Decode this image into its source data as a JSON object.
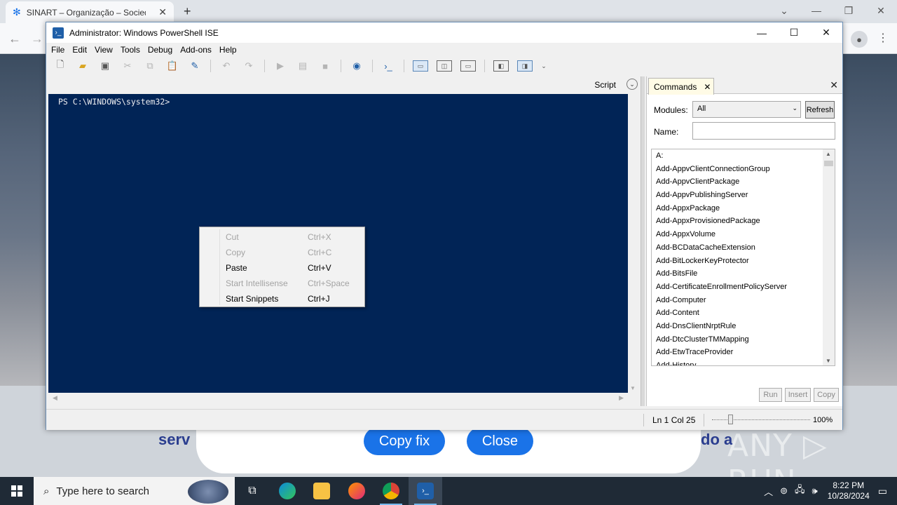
{
  "browser": {
    "tab_title": "SINART – Organização – Socieda",
    "tab_close": "✕",
    "new_tab": "+",
    "back": "←",
    "forward": "→",
    "controls": [
      "⌄",
      "—",
      "❐",
      "✕"
    ]
  },
  "webpage": {
    "lower_text_left": "serv",
    "lower_text_right": "do a",
    "copy_fix_label": "Copy fix",
    "close_label": "Close"
  },
  "watermark": "ANY ▷ RUN",
  "ise": {
    "title": "Administrator: Windows PowerShell ISE",
    "window_controls": [
      "—",
      "☐",
      "✕"
    ],
    "menu": [
      "File",
      "Edit",
      "View",
      "Tools",
      "Debug",
      "Add-ons",
      "Help"
    ],
    "script_label": "Script",
    "console_prompt": "PS C:\\WINDOWS\\system32>",
    "context_menu": [
      {
        "label": "Cut",
        "shortcut": "Ctrl+X",
        "enabled": false
      },
      {
        "label": "Copy",
        "shortcut": "Ctrl+C",
        "enabled": false
      },
      {
        "label": "Paste",
        "shortcut": "Ctrl+V",
        "enabled": true
      },
      {
        "label": "Start Intellisense",
        "shortcut": "Ctrl+Space",
        "enabled": false
      },
      {
        "label": "Start Snippets",
        "shortcut": "Ctrl+J",
        "enabled": true
      }
    ],
    "commands": {
      "tab_label": "Commands",
      "modules_label": "Modules:",
      "modules_value": "All",
      "refresh_label": "Refresh",
      "name_label": "Name:",
      "name_value": "",
      "items": [
        "A:",
        "Add-AppvClientConnectionGroup",
        "Add-AppvClientPackage",
        "Add-AppvPublishingServer",
        "Add-AppxPackage",
        "Add-AppxProvisionedPackage",
        "Add-AppxVolume",
        "Add-BCDataCacheExtension",
        "Add-BitLockerKeyProtector",
        "Add-BitsFile",
        "Add-CertificateEnrollmentPolicyServer",
        "Add-Computer",
        "Add-Content",
        "Add-DnsClientNrptRule",
        "Add-DtcClusterTMMapping",
        "Add-EtwTraceProvider",
        "Add-History"
      ],
      "run_label": "Run",
      "insert_label": "Insert",
      "copy_label": "Copy"
    },
    "status": {
      "position": "Ln 1  Col 25",
      "zoom": "100%"
    }
  },
  "taskbar": {
    "search_placeholder": "Type here to search",
    "time": "8:22 PM",
    "date": "10/28/2024"
  }
}
